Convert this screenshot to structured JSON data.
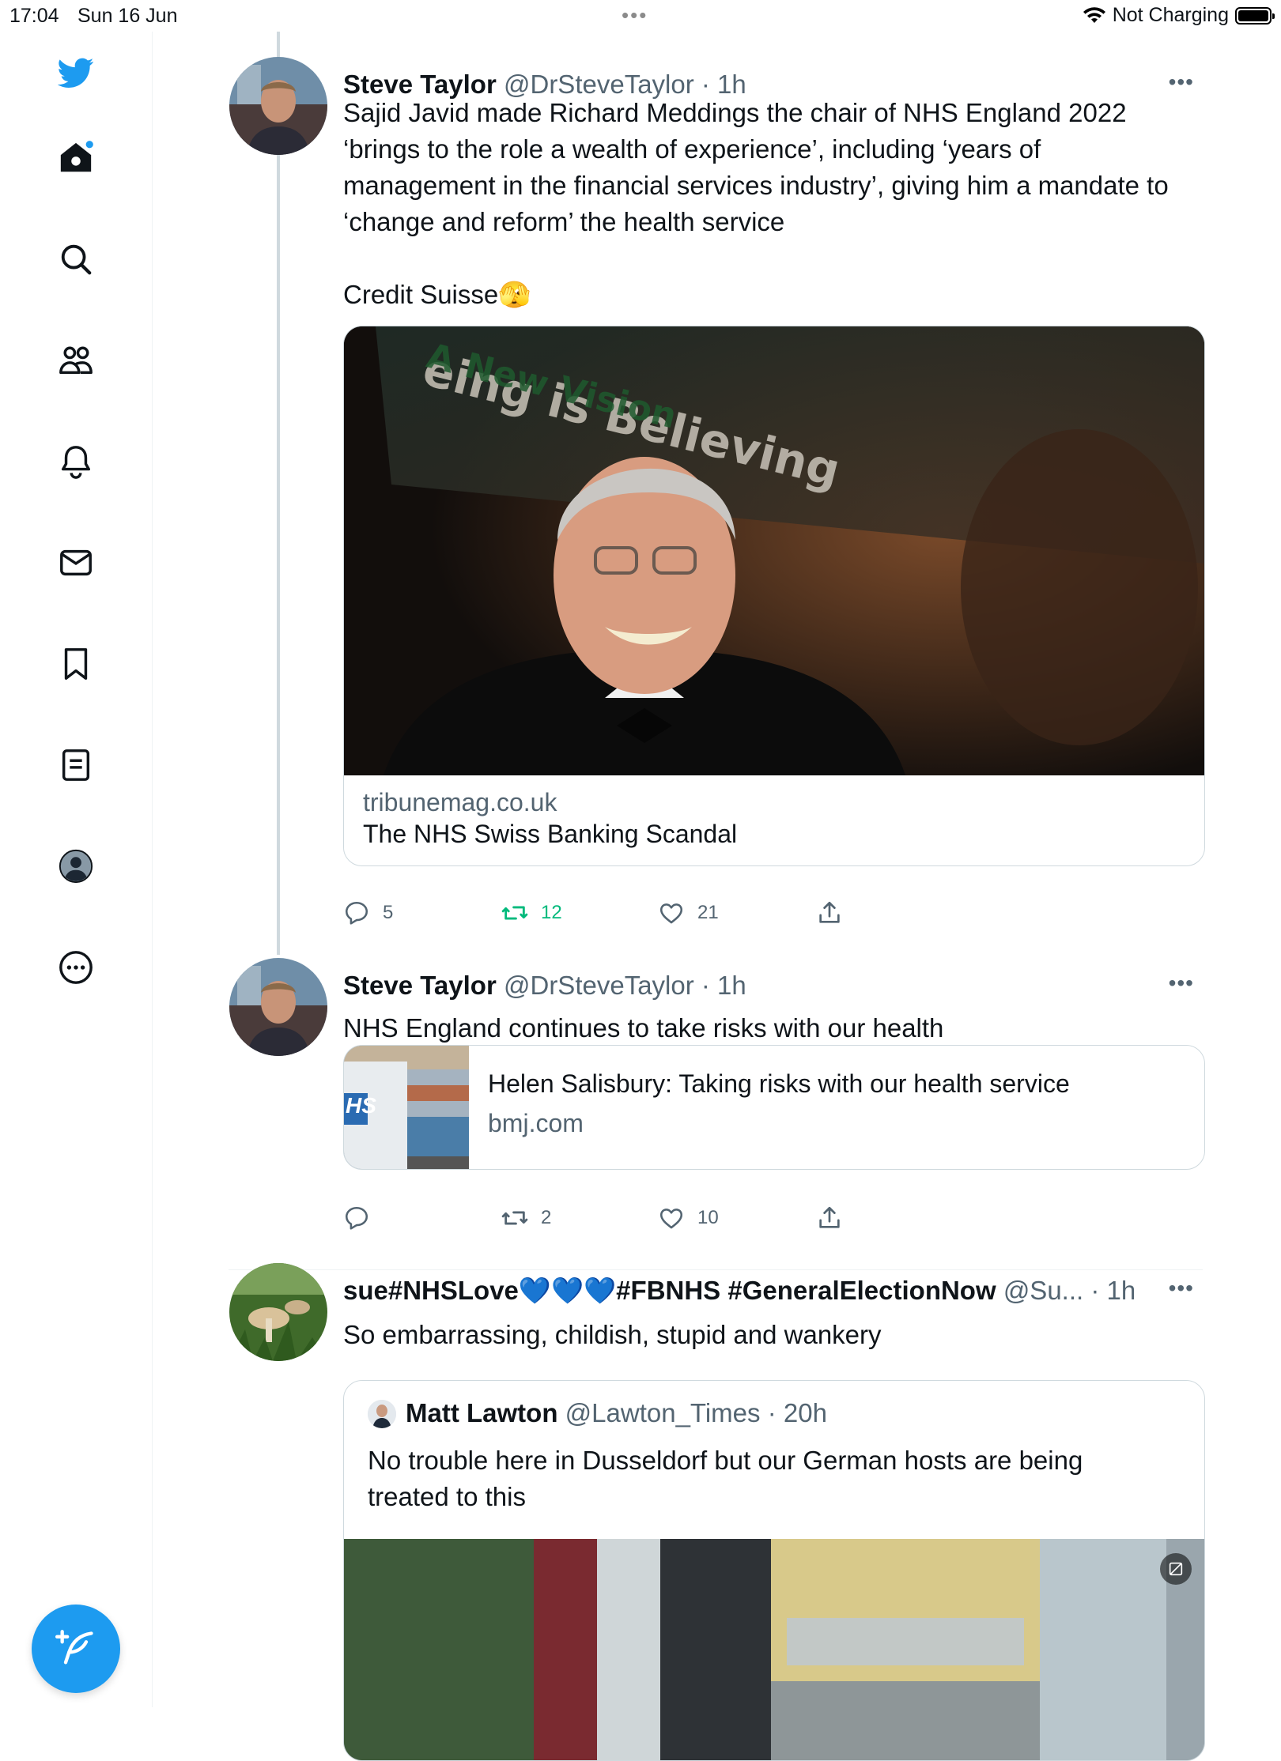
{
  "status_bar": {
    "time": "17:04",
    "date": "Sun 16 Jun",
    "battery_text": "Not Charging"
  },
  "sidebar": {
    "items": [
      "twitter-logo",
      "home-icon",
      "search-icon",
      "communities-icon",
      "notifications-icon",
      "messages-icon",
      "bookmarks-icon",
      "lists-icon",
      "profile-icon",
      "more-icon"
    ],
    "compose_icon": "compose-icon"
  },
  "tweets": [
    {
      "name": "Steve Taylor",
      "handle": "@DrSteveTaylor",
      "time": "· 1h",
      "text_lines": [
        "Sajid Javid made Richard Meddings the chair of NHS England 2022",
        "‘brings to the role a wealth of experience’, including ‘years of",
        "management in the financial services industry’, giving him a mandate to",
        "‘change and reform’ the health service"
      ],
      "text_tail": "Credit Suisse",
      "emoji": "🫣",
      "card": {
        "image_banner_line1": "eing is Believing",
        "image_banner_line2": "A New Vision",
        "domain": "tribunemag.co.uk",
        "title": "The NHS Swiss Banking Scandal"
      },
      "stats": {
        "replies": "5",
        "retweets": "12",
        "likes": "21"
      }
    },
    {
      "name": "Steve Taylor",
      "handle": "@DrSteveTaylor",
      "time": "· 1h",
      "text": "NHS England continues to take risks with our health",
      "card": {
        "title": "Helen Salisbury: Taking risks with our health service",
        "domain": "bmj.com",
        "thumb_label": "HS"
      },
      "stats": {
        "replies": "",
        "retweets": "2",
        "likes": "10"
      }
    },
    {
      "name": "sue#NHSLove💙💙💙#FBNHS #GeneralElectionNow",
      "handle": "@Su...",
      "time": "· 1h",
      "text": "So embarrassing, childish, stupid and wankery",
      "quote": {
        "name": "Matt Lawton",
        "handle": "@Lawton_Times",
        "time": "· 20h",
        "text_lines": [
          "No trouble here in Dusseldorf but our German hosts are being",
          "treated to this"
        ]
      }
    }
  ],
  "colors": {
    "accent": "#1d9bf0",
    "retweet_green": "#00ba7c",
    "secondary_text": "#536471",
    "border": "#cfd9de"
  }
}
